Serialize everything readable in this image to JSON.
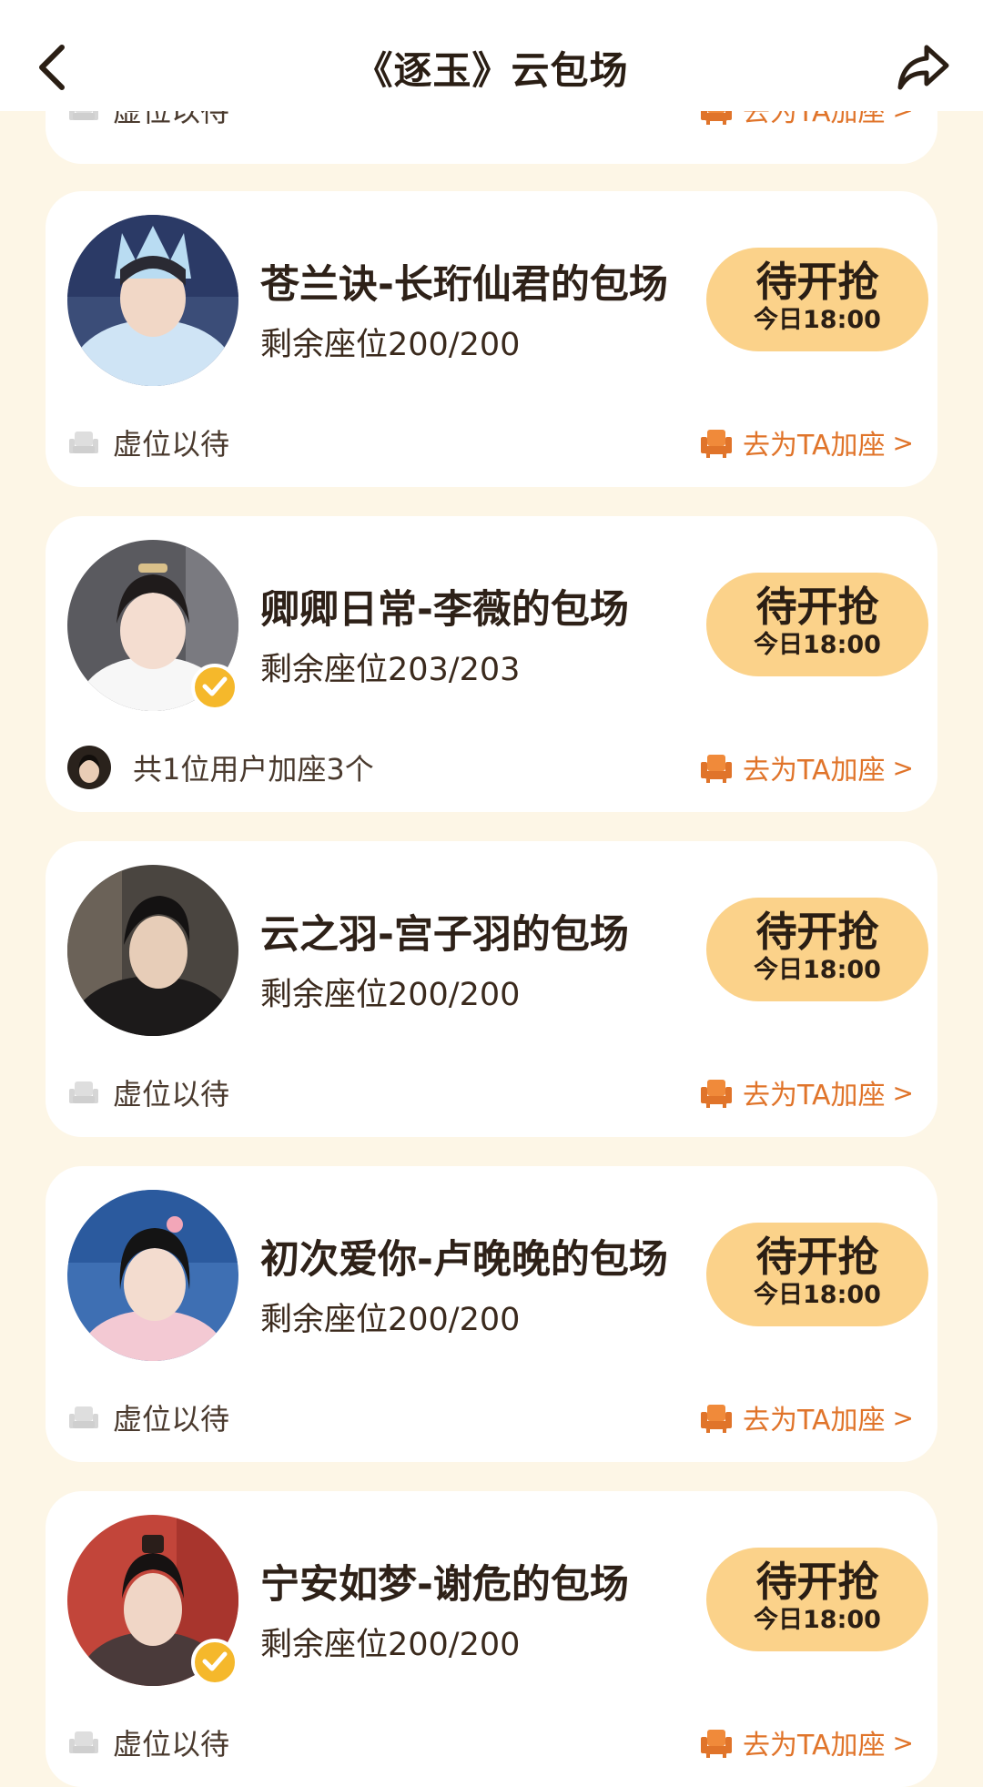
{
  "header": {
    "title": "《逐玉》云包场",
    "back_icon": "chevron-left-icon",
    "share_icon": "share-arrow-icon"
  },
  "colors": {
    "page_bg": "#fdf6e6",
    "button_bg": "#fbd28a",
    "accent_orange": "#e0742a",
    "verified_badge": "#f5b82b"
  },
  "partial_card": {
    "footer_left": "虚位以待",
    "add_seat_label": "去为TA加座",
    "chevron": ">"
  },
  "cards": [
    {
      "name": "苍兰诀-长珩仙君的包场",
      "seats": "剩余座位200/200",
      "status": "待开抢",
      "time": "今日18:00",
      "footer_left": "虚位以待",
      "add_seat_label": "去为TA加座",
      "chevron": ">",
      "verified": false
    },
    {
      "name": "卿卿日常-李薇的包场",
      "seats": "剩余座位203/203",
      "status": "待开抢",
      "time": "今日18:00",
      "footer_left": "共1位用户加座3个",
      "add_seat_label": "去为TA加座",
      "chevron": ">",
      "verified": true
    },
    {
      "name": "云之羽-宫子羽的包场",
      "seats": "剩余座位200/200",
      "status": "待开抢",
      "time": "今日18:00",
      "footer_left": "虚位以待",
      "add_seat_label": "去为TA加座",
      "chevron": ">",
      "verified": false
    },
    {
      "name": "初次爱你-卢晚晚的包场",
      "seats": "剩余座位200/200",
      "status": "待开抢",
      "time": "今日18:00",
      "footer_left": "虚位以待",
      "add_seat_label": "去为TA加座",
      "chevron": ">",
      "verified": false
    },
    {
      "name": "宁安如梦-谢危的包场",
      "seats": "剩余座位200/200",
      "status": "待开抢",
      "time": "今日18:00",
      "footer_left": "虚位以待",
      "add_seat_label": "去为TA加座",
      "chevron": ">",
      "verified": true
    }
  ]
}
